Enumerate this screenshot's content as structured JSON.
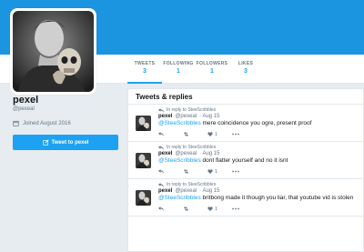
{
  "colors": {
    "banner": "#1b95e0",
    "accent": "#1da1f2",
    "muted": "#657786"
  },
  "profile": {
    "name": "pexel",
    "handle": "@pexeal",
    "joined": "Joined August 2016",
    "tweet_button": "Tweet to pexel",
    "avatar_icon": "profile-photo"
  },
  "stats": [
    {
      "label": "TWEETS",
      "value": "3"
    },
    {
      "label": "FOLLOWING",
      "value": "1"
    },
    {
      "label": "FOLLOWERS",
      "value": "1"
    },
    {
      "label": "LIKES",
      "value": "3"
    }
  ],
  "timeline": {
    "header": "Tweets & replies",
    "tweets": [
      {
        "reply_to": "In reply to SteeScribbles",
        "name": "pexel",
        "handle": "@pexeal",
        "time": "· Aug 15",
        "mention": "@SteeScribbles",
        "text": " mere coincidence you ogre, present proof",
        "likes": "1"
      },
      {
        "reply_to": "In reply to SteeScribbles",
        "name": "pexel",
        "handle": "@pexeal",
        "time": "· Aug 15",
        "mention": "@SteeScribbles",
        "text": " dont flatter yourself and no it isnt",
        "likes": "1"
      },
      {
        "reply_to": "In reply to SteeScribbles",
        "name": "pexel",
        "handle": "@pexeal",
        "time": "· Aug 15",
        "mention": "@SteeScribbles",
        "text": " britbong made it though you liar, that youtube vid is stolen",
        "likes": "1"
      }
    ]
  }
}
